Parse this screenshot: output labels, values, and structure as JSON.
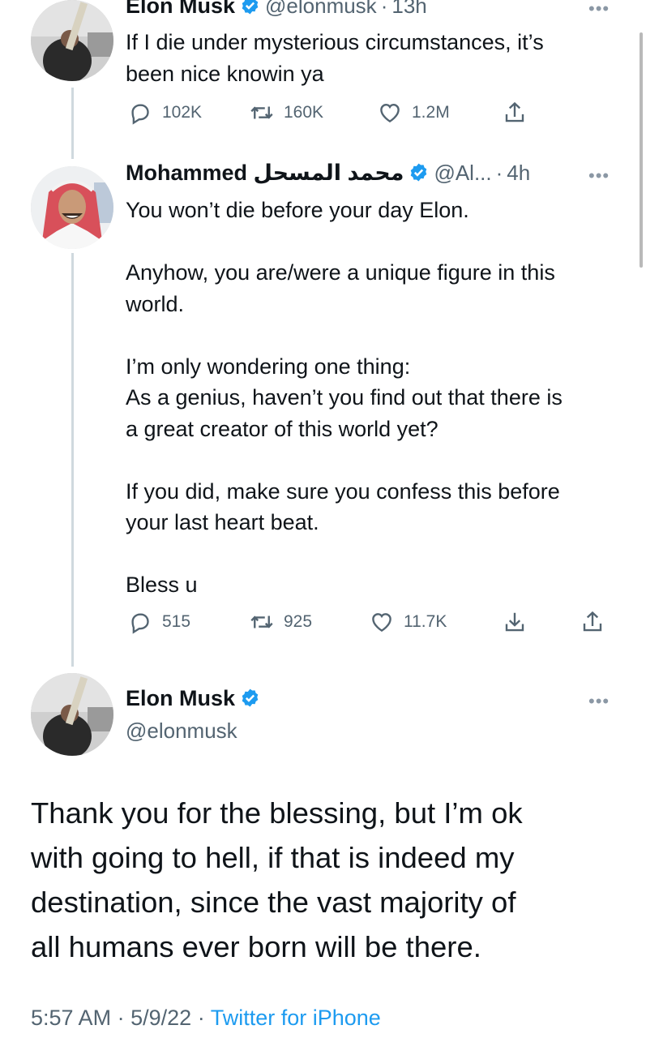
{
  "tweet1": {
    "name": "Elon Musk",
    "handle": "@elonmusk",
    "sep": "·",
    "time": "13h",
    "text": "If I die under mysterious circumstances, it’s\nbeen nice knowin ya",
    "replies": "102K",
    "retweets": "160K",
    "likes": "1.2M"
  },
  "tweet2": {
    "name": "Mohammed محمد المسحل",
    "handle": "@Al...",
    "sep": "·",
    "time": "4h",
    "text": "You won’t die before your day Elon.\n\nAnyhow, you are/were a unique figure in this\nworld.\n\nI’m only wondering one thing:\nAs a genius, haven’t you find out that there is\na great creator of this world yet?\n\nIf you did, make sure you confess this before\nyour last heart beat.\n\nBless u",
    "replies": "515",
    "retweets": "925",
    "likes": "11.7K"
  },
  "main_tweet": {
    "name": "Elon Musk",
    "handle": "@elonmusk",
    "text": "Thank you for the blessing, but I’m ok\nwith going to hell, if that is indeed my\ndestination, since the vast majority of\nall humans ever born will be there.",
    "time": "5:57 AM",
    "sep1": "·",
    "date": "5/9/22",
    "sep2": "·",
    "source": "Twitter for iPhone"
  },
  "icons": {
    "more": "•••",
    "verified_color": "#1d9bf0"
  }
}
